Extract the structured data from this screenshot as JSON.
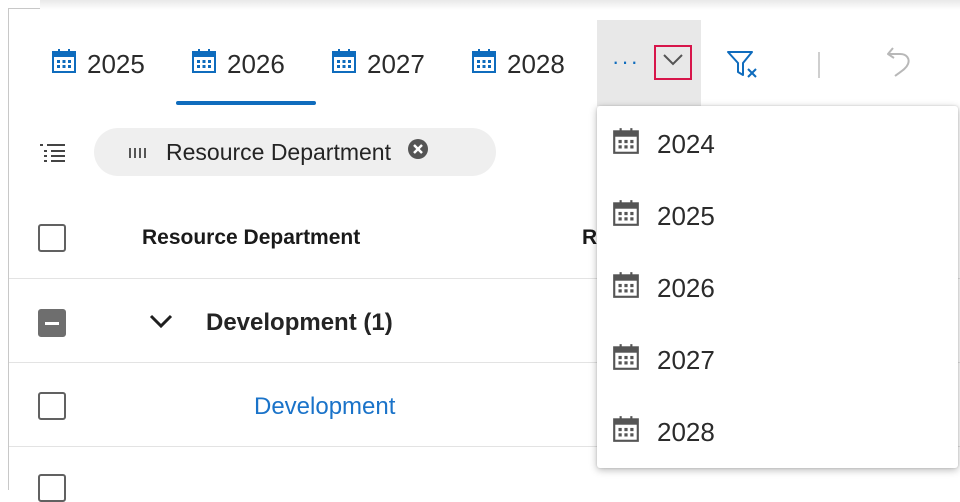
{
  "colors": {
    "accent": "#0f6cbd",
    "highlight_border": "#d7154a",
    "link": "#1a73c9"
  },
  "tabs": [
    {
      "label": "2025",
      "icon": "calendar-icon",
      "selected": false
    },
    {
      "label": "2026",
      "icon": "calendar-icon",
      "selected": true
    },
    {
      "label": "2027",
      "icon": "calendar-icon",
      "selected": false
    },
    {
      "label": "2028",
      "icon": "calendar-icon",
      "selected": false
    }
  ],
  "toolbar": {
    "more_label": "···",
    "icons": [
      "chevron-down-icon",
      "filter-clear-icon",
      "undo-icon"
    ]
  },
  "group_by": {
    "icon": "group-list-icon",
    "chip_label": "Resource Department",
    "chip_icons": [
      "grip-icon",
      "clear-icon"
    ]
  },
  "table": {
    "headers": {
      "col1": "Resource Department",
      "col2_partial": "R"
    },
    "rows": [
      {
        "type": "group",
        "label": "Development (1)",
        "checkbox": "partial"
      },
      {
        "type": "item",
        "label": "Development",
        "checkbox": "unchecked"
      }
    ]
  },
  "dropdown": {
    "items": [
      "2024",
      "2025",
      "2026",
      "2027",
      "2028"
    ]
  }
}
